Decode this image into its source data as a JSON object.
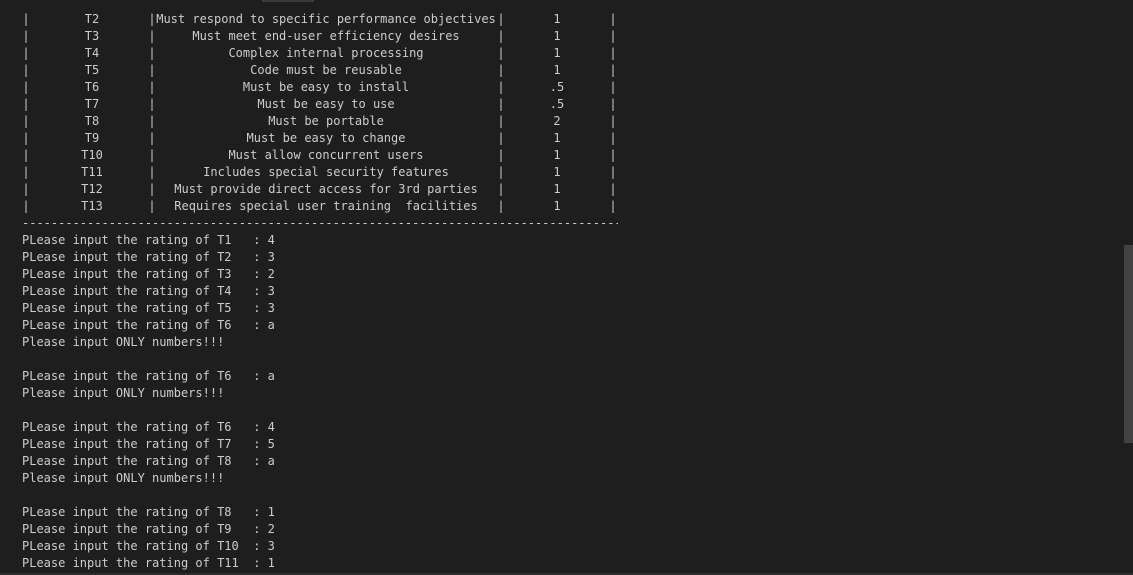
{
  "terminal": {
    "table_rows": [
      {
        "pipe1": "|",
        "id": "T2",
        "pipe2": "|",
        "desc": "Must respond to specific performance objectives",
        "pipe3": "|",
        "weight": "1",
        "pipe4": "|"
      },
      {
        "pipe1": "|",
        "id": "T3",
        "pipe2": "|",
        "desc": "Must meet end-user efficiency desires",
        "pipe3": "|",
        "weight": "1",
        "pipe4": "|"
      },
      {
        "pipe1": "|",
        "id": "T4",
        "pipe2": "|",
        "desc": "Complex internal processing",
        "pipe3": "|",
        "weight": "1",
        "pipe4": "|"
      },
      {
        "pipe1": "|",
        "id": "T5",
        "pipe2": "|",
        "desc": "Code must be reusable",
        "pipe3": "|",
        "weight": "1",
        "pipe4": "|"
      },
      {
        "pipe1": "|",
        "id": "T6",
        "pipe2": "|",
        "desc": "Must be easy to install",
        "pipe3": "|",
        "weight": ".5",
        "pipe4": "|"
      },
      {
        "pipe1": "|",
        "id": "T7",
        "pipe2": "|",
        "desc": "Must be easy to use",
        "pipe3": "|",
        "weight": ".5",
        "pipe4": "|"
      },
      {
        "pipe1": "|",
        "id": "T8",
        "pipe2": "|",
        "desc": "Must be portable",
        "pipe3": "|",
        "weight": "2",
        "pipe4": "|"
      },
      {
        "pipe1": "|",
        "id": "T9",
        "pipe2": "|",
        "desc": "Must be easy to change",
        "pipe3": "|",
        "weight": "1",
        "pipe4": "|"
      },
      {
        "pipe1": "|",
        "id": "T10",
        "pipe2": "|",
        "desc": "Must allow concurrent users",
        "pipe3": "|",
        "weight": "1",
        "pipe4": "|"
      },
      {
        "pipe1": "|",
        "id": "T11",
        "pipe2": "|",
        "desc": "Includes special security features",
        "pipe3": "|",
        "weight": "1",
        "pipe4": "|"
      },
      {
        "pipe1": "|",
        "id": "T12",
        "pipe2": "|",
        "desc": "Must provide direct access for 3rd parties",
        "pipe3": "|",
        "weight": "1",
        "pipe4": "|"
      },
      {
        "pipe1": "|",
        "id": "T13",
        "pipe2": "|",
        "desc": "Requires special user training  facilities",
        "pipe3": "|",
        "weight": "1",
        "pipe4": "|"
      }
    ],
    "separator": "------------------------------------------------------------------------------------------------------------------",
    "output_lines": [
      "PLease input the rating of T1   : 4",
      "PLease input the rating of T2   : 3",
      "PLease input the rating of T3   : 2",
      "PLease input the rating of T4   : 3",
      "PLease input the rating of T5   : 3",
      "PLease input the rating of T6   : a",
      "Please input ONLY numbers!!!",
      "",
      "PLease input the rating of T6   : a",
      "Please input ONLY numbers!!!",
      "",
      "PLease input the rating of T6   : 4",
      "PLease input the rating of T7   : 5",
      "PLease input the rating of T8   : a",
      "Please input ONLY numbers!!!",
      "",
      "PLease input the rating of T8   : 1",
      "PLease input the rating of T9   : 2",
      "PLease input the rating of T10  : 3",
      "PLease input the rating of T11  : 1"
    ]
  }
}
